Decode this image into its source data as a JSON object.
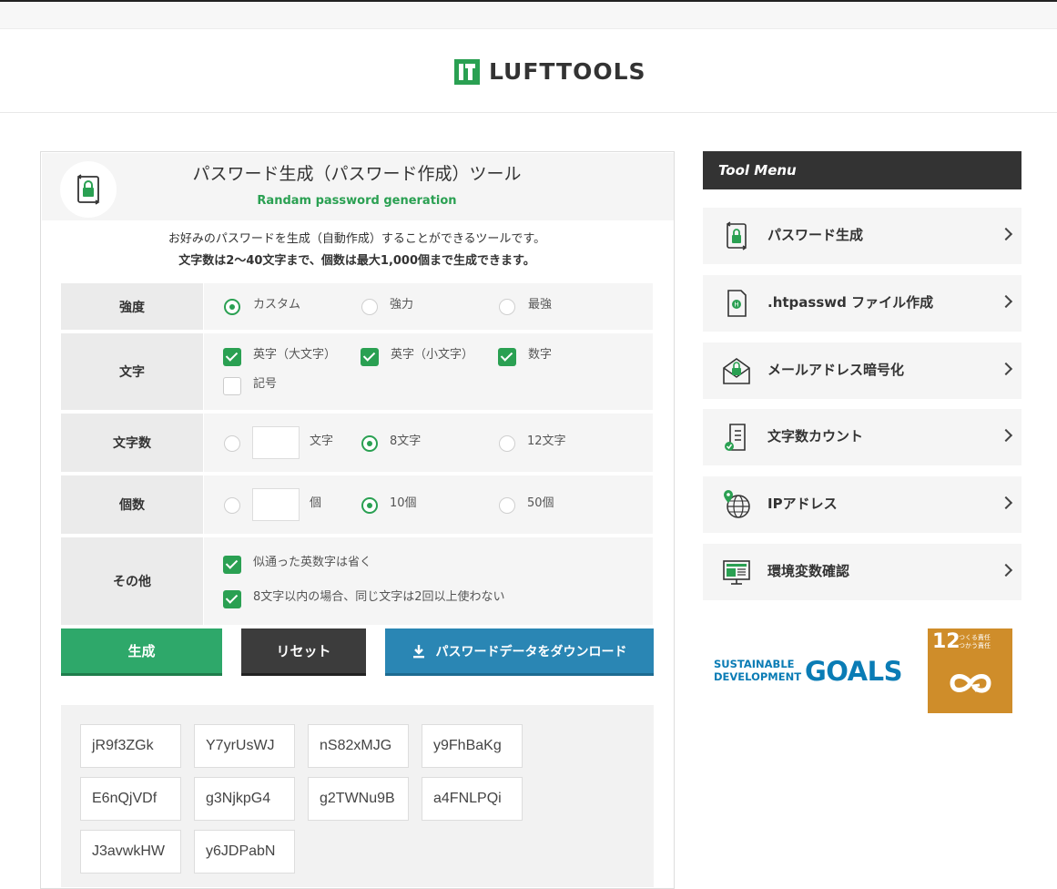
{
  "header": {
    "logo_text": "LUFTTOOLS"
  },
  "tool": {
    "title": "パスワード生成（パスワード作成）ツール",
    "subtitle": "Randam password generation",
    "desc_line1": "お好みのパスワードを生成（自動作成）することができるツールです。",
    "desc_line2": "文字数は2～40文字まで、個数は最大1,000個まで生成できます。"
  },
  "form": {
    "strength": {
      "label": "強度",
      "options": [
        "カスタム",
        "強力",
        "最強"
      ],
      "selected": "カスタム"
    },
    "chars": {
      "label": "文字",
      "options": [
        "英字（大文字）",
        "英字（小文字）",
        "数字",
        "記号"
      ],
      "checked": [
        "英字（大文字）",
        "英字（小文字）",
        "数字"
      ]
    },
    "length": {
      "label": "文字数",
      "custom_value": "",
      "custom_unit": "文字",
      "options": [
        "8文字",
        "12文字"
      ],
      "selected": "8文字"
    },
    "count": {
      "label": "個数",
      "custom_value": "",
      "custom_unit": "個",
      "options": [
        "10個",
        "50個"
      ],
      "selected": "10個"
    },
    "other": {
      "label": "その他",
      "options": [
        "似通った英数字は省く",
        "8文字以内の場合、同じ文字は2回以上使わない"
      ],
      "checked": [
        "似通った英数字は省く",
        "8文字以内の場合、同じ文字は2回以上使わない"
      ]
    }
  },
  "buttons": {
    "generate": "生成",
    "reset": "リセット",
    "download": "パスワードデータをダウンロード"
  },
  "results": [
    "jR9f3ZGk",
    "Y7yrUsWJ",
    "nS82xMJG",
    "y9FhBaKg",
    "E6nQjVDf",
    "g3NjkpG4",
    "g2TWNu9B",
    "a4FNLPQi",
    "J3avwkHW",
    "y6JDPabN"
  ],
  "sidebar": {
    "title": "Tool Menu",
    "items": [
      {
        "label": "パスワード生成",
        "icon": "password-lock-icon"
      },
      {
        "label": ".htpasswd ファイル作成",
        "icon": "htpasswd-file-icon"
      },
      {
        "label": "メールアドレス暗号化",
        "icon": "mail-lock-icon"
      },
      {
        "label": "文字数カウント",
        "icon": "document-count-icon"
      },
      {
        "label": "IPアドレス",
        "icon": "globe-pin-icon"
      },
      {
        "label": "環境変数確認",
        "icon": "monitor-icon"
      }
    ]
  },
  "sdg": {
    "line1": "SUSTAINABLE",
    "line2": "DEVELOPMENT",
    "goals": "GOALS",
    "goal_number": "12",
    "goal_text_1": "つくる責任",
    "goal_text_2": "つかう責任"
  },
  "colors": {
    "accent_green": "#2aa052",
    "generate_btn": "#2ea86a",
    "reset_btn": "#3c3c3c",
    "download_btn": "#2a86b4",
    "menu_head": "#333333",
    "sdg12": "#cf8d2a"
  }
}
